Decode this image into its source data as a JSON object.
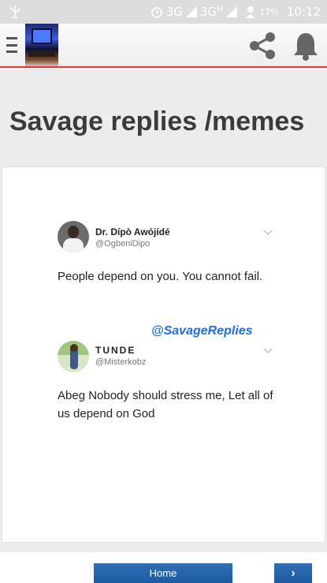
{
  "status_bar": {
    "network_1": "3G",
    "network_2": "3G",
    "network_2_sup": "H",
    "battery": "17%",
    "time": "10:12"
  },
  "app_bar": {
    "logo_icon": "pc-setup-logo",
    "share_icon": "share-icon",
    "bell_icon": "bell-icon"
  },
  "post": {
    "title": "Savage replies /memes",
    "image": {
      "tweet_1": {
        "name": "Dr. Dípò Awójídé",
        "handle": "@OgbeniDipo",
        "text": "People depend on you. You cannot fail."
      },
      "watermark": "@SavageReplies",
      "tweet_2": {
        "name": "TUNDE",
        "handle": "@Misterkobz",
        "text": "Abeg Nobody should stress me, Let all of us depend on God"
      }
    }
  },
  "bottom_nav": {
    "home_label": "Home",
    "next_label": "›"
  },
  "colors": {
    "accent_line": "#e53935",
    "button_blue": "#1d5aa1",
    "watermark_blue": "#1d6ee6"
  }
}
